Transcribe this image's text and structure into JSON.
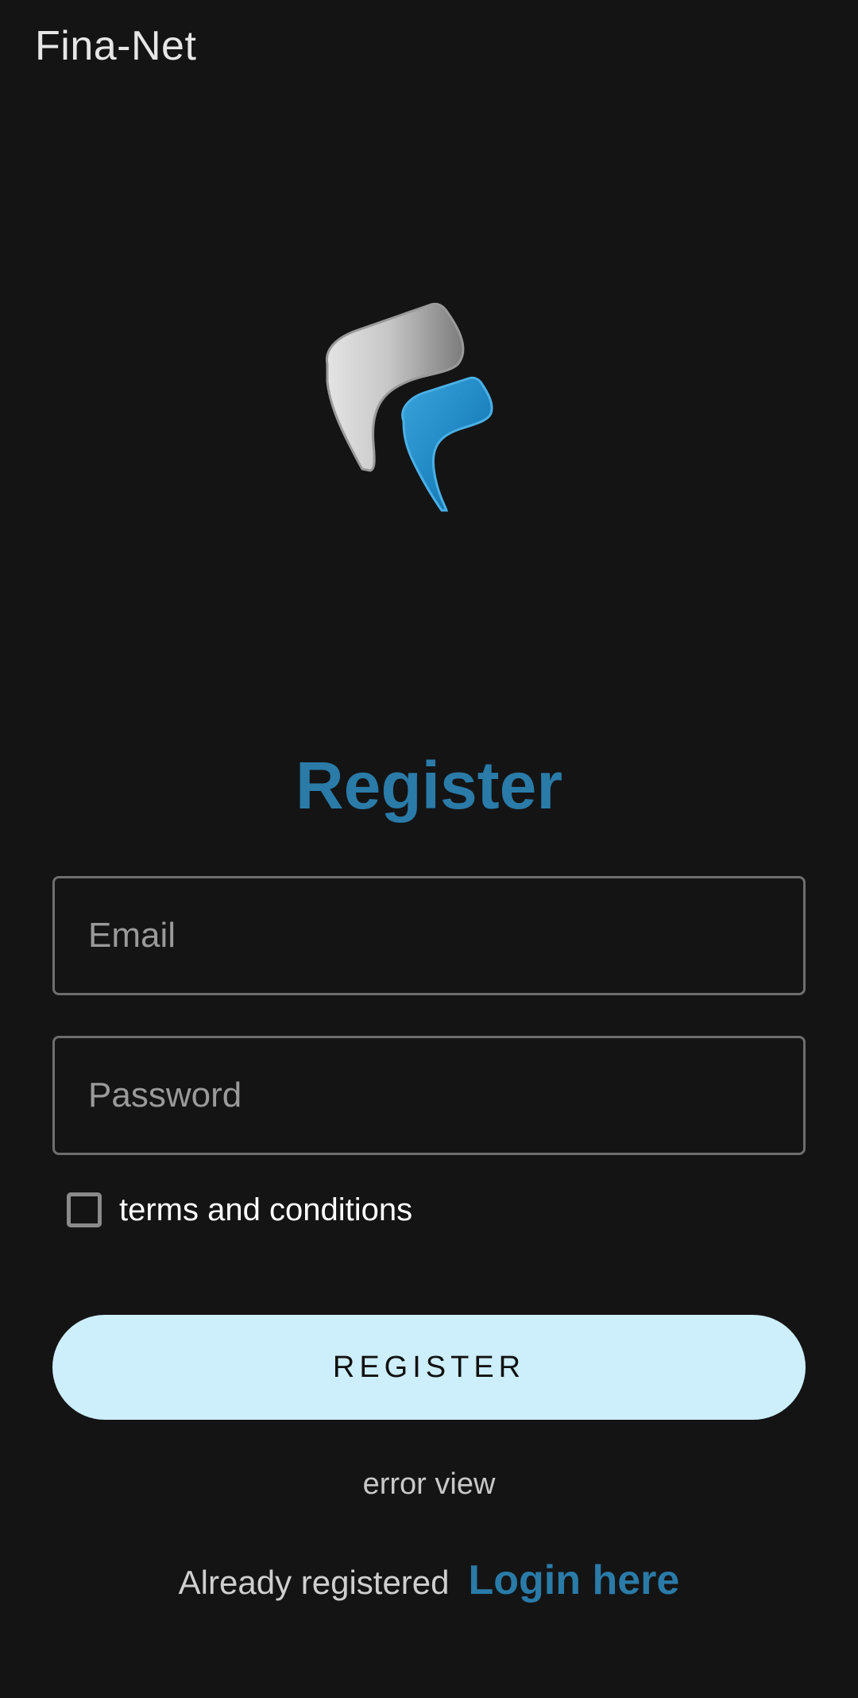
{
  "app": {
    "title": "Fina-Net",
    "brand_color": "#2a7ba8",
    "background": "#141415"
  },
  "logo": {
    "icon": "fina-net-logo-icon"
  },
  "form": {
    "heading": "Register",
    "email": {
      "placeholder": "Email",
      "value": ""
    },
    "password": {
      "placeholder": "Password",
      "value": ""
    },
    "terms": {
      "label": "terms and conditions",
      "checked": false
    },
    "submit_label": "REGISTER",
    "submit_color": "#cdeefb",
    "error_text": "error view"
  },
  "footer": {
    "prompt": "Already registered",
    "login_link": "Login here"
  }
}
